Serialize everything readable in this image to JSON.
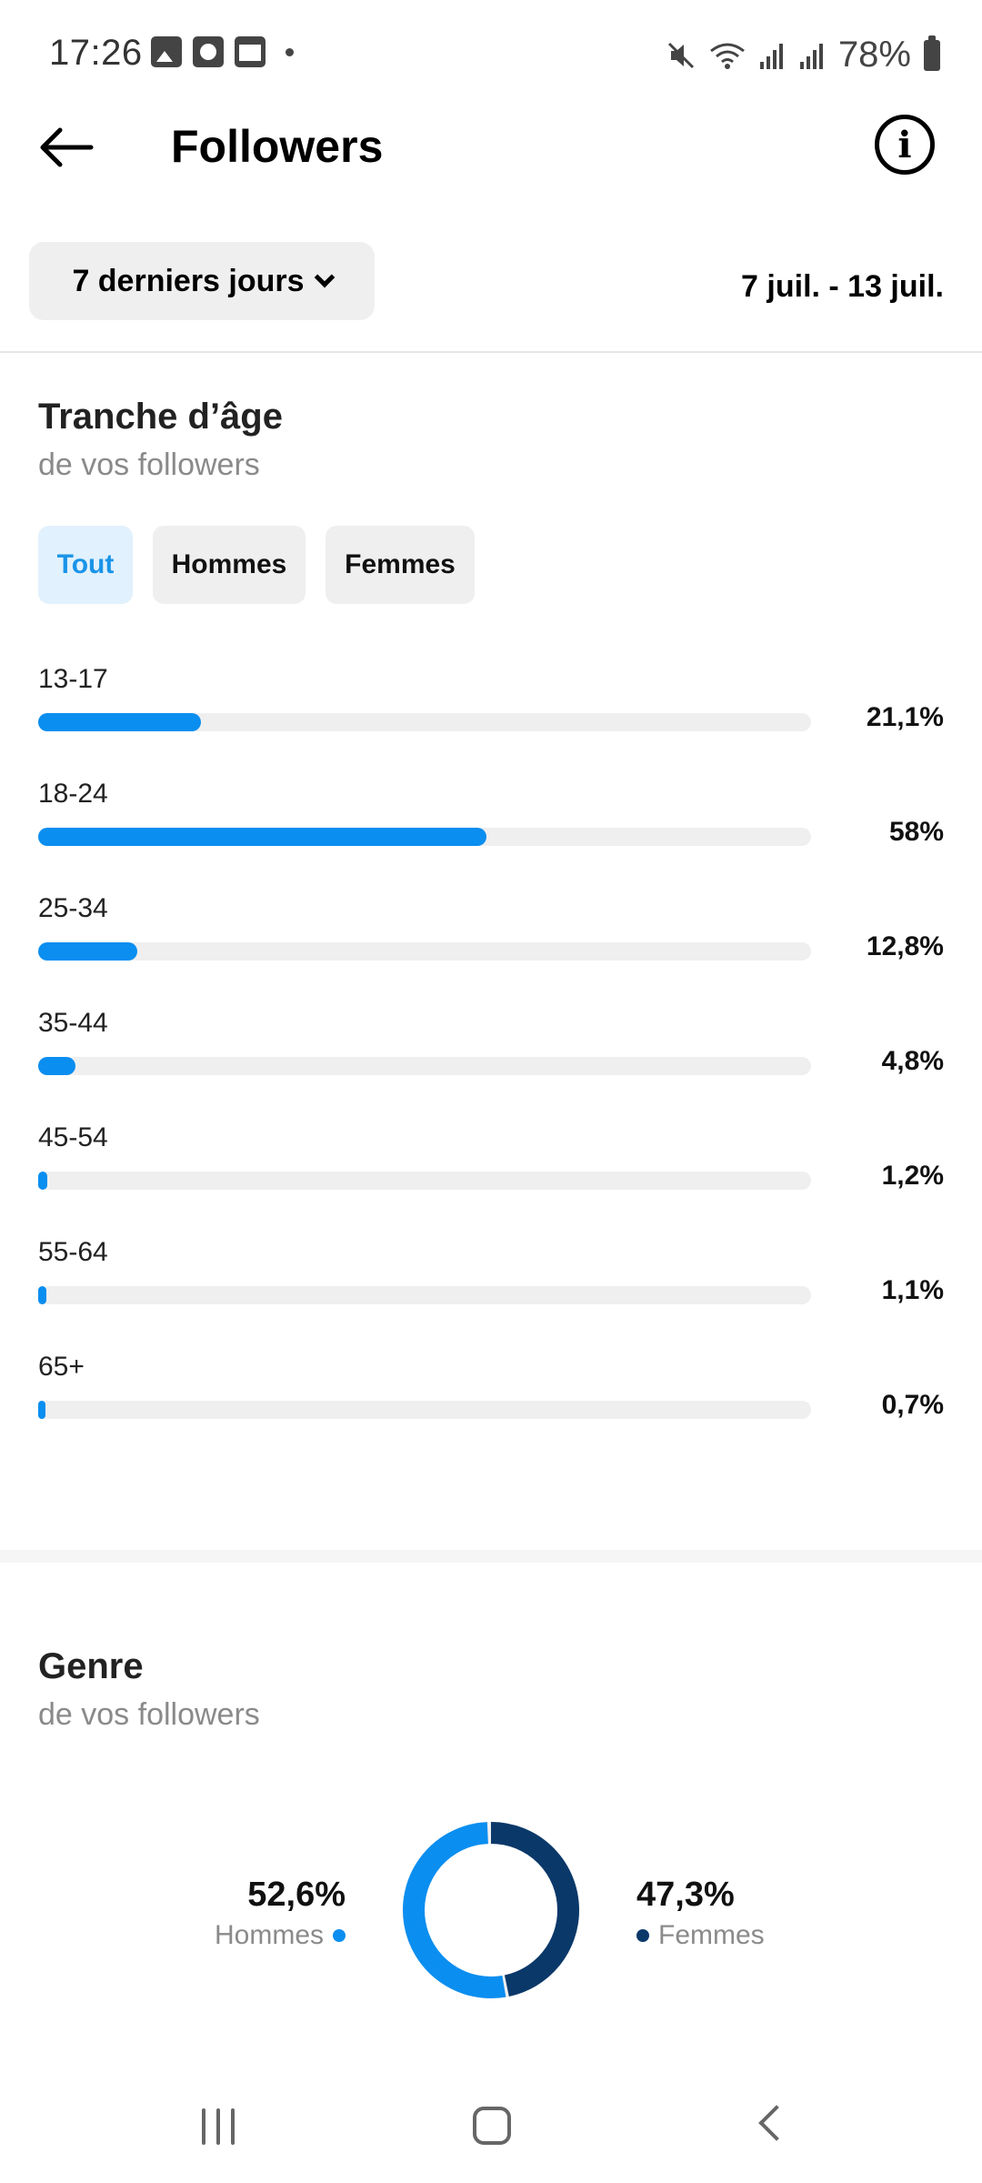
{
  "status_bar": {
    "time": "17:26",
    "battery": "78%"
  },
  "header": {
    "title": "Followers"
  },
  "filter": {
    "period_label": "7 derniers jours",
    "date_range": "7 juil. - 13 juil."
  },
  "age_section": {
    "title": "Tranche d’âge",
    "subtitle": "de vos followers",
    "tabs": [
      {
        "label": "Tout",
        "active": true
      },
      {
        "label": "Hommes",
        "active": false
      },
      {
        "label": "Femmes",
        "active": false
      }
    ],
    "rows": [
      {
        "label": "13-17",
        "value": "21,1%",
        "fraction": 0.211
      },
      {
        "label": "18-24",
        "value": "58%",
        "fraction": 0.58
      },
      {
        "label": "25-34",
        "value": "12,8%",
        "fraction": 0.128
      },
      {
        "label": "35-44",
        "value": "4,8%",
        "fraction": 0.048
      },
      {
        "label": "45-54",
        "value": "1,2%",
        "fraction": 0.012
      },
      {
        "label": "55-64",
        "value": "1,1%",
        "fraction": 0.011
      },
      {
        "label": "65+",
        "value": "0,7%",
        "fraction": 0.007
      }
    ]
  },
  "gender_section": {
    "title": "Genre",
    "subtitle": "de vos followers",
    "men": {
      "label": "Hommes",
      "value": "52,6%",
      "fraction": 0.526
    },
    "women": {
      "label": "Femmes",
      "value": "47,3%",
      "fraction": 0.473
    }
  },
  "colors": {
    "accent_blue": "#0a8ef0",
    "dark_blue": "#0a3869",
    "track": "#efefef"
  },
  "chart_data": [
    {
      "type": "bar",
      "categories": [
        "13-17",
        "18-24",
        "25-34",
        "35-44",
        "45-54",
        "55-64",
        "65+"
      ],
      "values": [
        21.1,
        58,
        12.8,
        4.8,
        1.2,
        1.1,
        0.7
      ],
      "title": "Tranche d’âge"
    },
    {
      "type": "pie",
      "categories": [
        "Hommes",
        "Femmes"
      ],
      "values": [
        52.6,
        47.3
      ],
      "title": "Genre"
    }
  ]
}
